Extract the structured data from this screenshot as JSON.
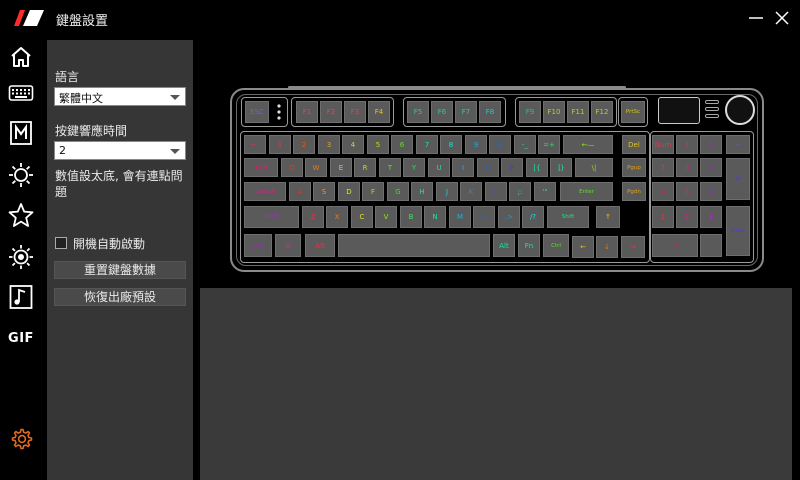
{
  "app": {
    "title": "鍵盤設置"
  },
  "window": {
    "minimize_icon": "minimize-icon",
    "close_icon": "close-icon"
  },
  "rail": {
    "items": [
      {
        "name": "home-icon"
      },
      {
        "name": "keyboard-icon"
      },
      {
        "name": "macro-icon",
        "text": "M"
      },
      {
        "name": "lighting-icon"
      },
      {
        "name": "star-icon"
      },
      {
        "name": "brightness-icon"
      },
      {
        "name": "music-icon"
      },
      {
        "name": "gif-icon",
        "text": "GIF"
      },
      {
        "name": "settings-icon"
      }
    ],
    "settings_color": "#e06a1e"
  },
  "settings": {
    "language_label": "語言",
    "language_value": "繁體中文",
    "response_label": "按鍵響應時間",
    "response_value": "2",
    "response_note": "數值設太底, 會有連點問題",
    "autostart_label": "開機自動啟動",
    "autostart_checked": false,
    "reset_keys_label": "重置鍵盤數據",
    "factory_reset_label": "恢復出廠預設"
  },
  "keyboard": {
    "rows": [
      {
        "keys": [
          {
            "l": "ESC",
            "c": "#6a5cff"
          },
          {
            "l": "F1",
            "c": "#ff3b3b"
          },
          {
            "l": "F2",
            "c": "#ff3b3b"
          },
          {
            "l": "F3",
            "c": "#ff3b3b"
          },
          {
            "l": "F4",
            "c": "#e6c31a"
          },
          {
            "l": "F5",
            "c": "#23c9a5"
          },
          {
            "l": "F6",
            "c": "#23c9a5"
          },
          {
            "l": "F7",
            "c": "#23c9c9"
          },
          {
            "l": "F8",
            "c": "#23c9c9"
          },
          {
            "l": "F9",
            "c": "#23c96a"
          },
          {
            "l": "F10",
            "c": "#9ee01a"
          },
          {
            "l": "F11",
            "c": "#9ee01a"
          },
          {
            "l": "F12",
            "c": "#9ee01a"
          },
          {
            "l": "PrtSc",
            "c": "#d8c31a"
          }
        ]
      },
      {
        "keys": [
          {
            "l": "~`",
            "c": "#e2344a"
          },
          {
            "l": "1",
            "c": "#e2344a"
          },
          {
            "l": "2",
            "c": "#e25a1a"
          },
          {
            "l": "3",
            "c": "#e2a01a"
          },
          {
            "l": "4",
            "c": "#e2d21a"
          },
          {
            "l": "5",
            "c": "#b0e21a"
          },
          {
            "l": "6",
            "c": "#5ae21a"
          },
          {
            "l": "7",
            "c": "#1ae28a"
          },
          {
            "l": "8",
            "c": "#1ae2d2"
          },
          {
            "l": "9",
            "c": "#1aa8e2"
          },
          {
            "l": "0",
            "c": "#1a6ae2"
          },
          {
            "l": "-_",
            "c": "#23e29a"
          },
          {
            "l": "=+",
            "c": "#23e26a"
          },
          {
            "l": "←—",
            "c": "#9ae21a"
          },
          {
            "l": "Del",
            "c": "#e2c21a"
          },
          {
            "l": "Num",
            "c": "#e2344a"
          },
          {
            "l": "/",
            "c": "#e2344a"
          },
          {
            "l": "*",
            "c": "#c21ae2"
          },
          {
            "l": "-",
            "c": "#6a5cff"
          }
        ]
      },
      {
        "keys": [
          {
            "l": "TAB",
            "c": "#e21a6a"
          },
          {
            "l": "Q",
            "c": "#e23a1a"
          },
          {
            "l": "W",
            "c": "#e27a1a"
          },
          {
            "l": "E",
            "c": "#e2c21a"
          },
          {
            "l": "R",
            "c": "#b0e21a"
          },
          {
            "l": "T",
            "c": "#5ae21a"
          },
          {
            "l": "Y",
            "c": "#1ae25a"
          },
          {
            "l": "U",
            "c": "#1ae2b0"
          },
          {
            "l": "I",
            "c": "#1ab0e2"
          },
          {
            "l": "O",
            "c": "#1a6ae2"
          },
          {
            "l": "P",
            "c": "#3a3ae2"
          },
          {
            "l": "[{",
            "c": "#23e2a0"
          },
          {
            "l": "]}",
            "c": "#23e2a0"
          },
          {
            "l": "\\|",
            "c": "#9ae21a"
          },
          {
            "l": "Pgup",
            "c": "#e2a01a"
          },
          {
            "l": "7",
            "c": "#e2344a"
          },
          {
            "l": "8",
            "c": "#e21a8a"
          },
          {
            "l": "9",
            "c": "#b01ae2"
          },
          {
            "l": "+",
            "c": "#4a3ae2"
          }
        ]
      },
      {
        "keys": [
          {
            "l": "CapsLk",
            "c": "#e21a8a"
          },
          {
            "l": "A",
            "c": "#e2341a"
          },
          {
            "l": "S",
            "c": "#e2a01a"
          },
          {
            "l": "D",
            "c": "#e2e21a"
          },
          {
            "l": "F",
            "c": "#9ae21a"
          },
          {
            "l": "G",
            "c": "#3ae21a"
          },
          {
            "l": "H",
            "c": "#1ae29a"
          },
          {
            "l": "J",
            "c": "#1ad2e2"
          },
          {
            "l": "K",
            "c": "#1a8ae2"
          },
          {
            "l": "L",
            "c": "#3a4ae2"
          },
          {
            "l": ";:",
            "c": "#1ae2c2"
          },
          {
            "l": "'\"",
            "c": "#1ae2a0"
          },
          {
            "l": "Enter",
            "c": "#5ae21a"
          },
          {
            "l": "Pgdn",
            "c": "#e2a01a"
          },
          {
            "l": "4",
            "c": "#e21a5a"
          },
          {
            "l": "5",
            "c": "#e21aa0"
          },
          {
            "l": "6",
            "c": "#a01ae2"
          }
        ]
      },
      {
        "keys": [
          {
            "l": "Shift",
            "c": "#c21ae2"
          },
          {
            "l": "Z",
            "c": "#e2344a"
          },
          {
            "l": "X",
            "c": "#e27a1a"
          },
          {
            "l": "C",
            "c": "#e2e21a"
          },
          {
            "l": "V",
            "c": "#9ae21a"
          },
          {
            "l": "B",
            "c": "#3ae25a"
          },
          {
            "l": "N",
            "c": "#1ae2b0"
          },
          {
            "l": "M",
            "c": "#1ab0e2"
          },
          {
            "l": ",<",
            "c": "#1a6ae2"
          },
          {
            "l": ".>",
            "c": "#1a9ae2"
          },
          {
            "l": "/?",
            "c": "#1ae2e2"
          },
          {
            "l": "Shift",
            "c": "#1ae28a"
          },
          {
            "l": "↑",
            "c": "#e2c21a"
          },
          {
            "l": "1",
            "c": "#e2344a"
          },
          {
            "l": "2",
            "c": "#e21a8a"
          },
          {
            "l": "3",
            "c": "#c21ae2"
          },
          {
            "l": "Enter",
            "c": "#4a3ae2"
          }
        ]
      },
      {
        "keys": [
          {
            "l": "Ctrl",
            "c": "#b01ae2"
          },
          {
            "l": "⊞",
            "c": "#e21aa0"
          },
          {
            "l": "Alt",
            "c": "#e2344a"
          },
          {
            "l": "",
            "c": "#cccccc"
          },
          {
            "l": "Alt",
            "c": "#1ae2a0"
          },
          {
            "l": "Fn",
            "c": "#1ae2c2"
          },
          {
            "l": "Ctrl",
            "c": "#5ae21a"
          },
          {
            "l": "←",
            "c": "#e2c21a"
          },
          {
            "l": "↓",
            "c": "#e27a1a"
          },
          {
            "l": "→",
            "c": "#e2344a"
          },
          {
            "l": "0",
            "c": "#e21a6a"
          },
          {
            "l": ".",
            "c": "#a01ae2"
          }
        ]
      }
    ]
  }
}
